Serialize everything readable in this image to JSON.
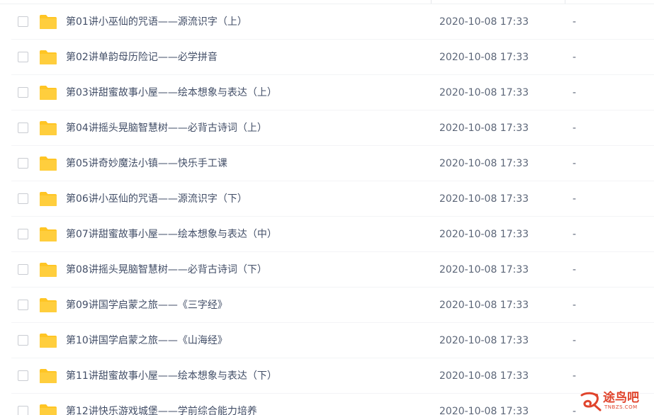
{
  "files": [
    {
      "name": "第01讲小巫仙的咒语——源流识字（上）",
      "modified": "2020-10-08 17:33",
      "size": "-"
    },
    {
      "name": "第02讲单韵母历险记——必学拼音",
      "modified": "2020-10-08 17:33",
      "size": "-"
    },
    {
      "name": "第03讲甜蜜故事小屋——绘本想象与表达（上）",
      "modified": "2020-10-08 17:33",
      "size": "-"
    },
    {
      "name": "第04讲摇头晃脑智慧树——必背古诗词（上）",
      "modified": "2020-10-08 17:33",
      "size": "-"
    },
    {
      "name": "第05讲奇妙魔法小镇——快乐手工课",
      "modified": "2020-10-08 17:33",
      "size": "-"
    },
    {
      "name": "第06讲小巫仙的咒语——源流识字（下）",
      "modified": "2020-10-08 17:33",
      "size": "-"
    },
    {
      "name": "第07讲甜蜜故事小屋——绘本想象与表达（中）",
      "modified": "2020-10-08 17:33",
      "size": "-"
    },
    {
      "name": "第08讲摇头晃脑智慧树——必背古诗词（下）",
      "modified": "2020-10-08 17:33",
      "size": "-"
    },
    {
      "name": "第09讲国学启蒙之旅——《三字经》",
      "modified": "2020-10-08 17:33",
      "size": "-"
    },
    {
      "name": "第10讲国学启蒙之旅——《山海经》",
      "modified": "2020-10-08 17:33",
      "size": "-"
    },
    {
      "name": "第11讲甜蜜故事小屋——绘本想象与表达（下）",
      "modified": "2020-10-08 17:33",
      "size": "-"
    },
    {
      "name": "第12讲快乐游戏城堡——学前综合能力培养",
      "modified": "2020-10-08 17:33",
      "size": "-"
    }
  ],
  "watermark": {
    "text": "途鸟吧",
    "sub": "TNBZS.COM"
  },
  "colors": {
    "folder": "#ffc524",
    "folder_dark": "#f5b90f",
    "watermark": "#e0442c"
  },
  "icons": {
    "row_icon": "folder-icon",
    "watermark_icon": "tn-logo-icon"
  }
}
